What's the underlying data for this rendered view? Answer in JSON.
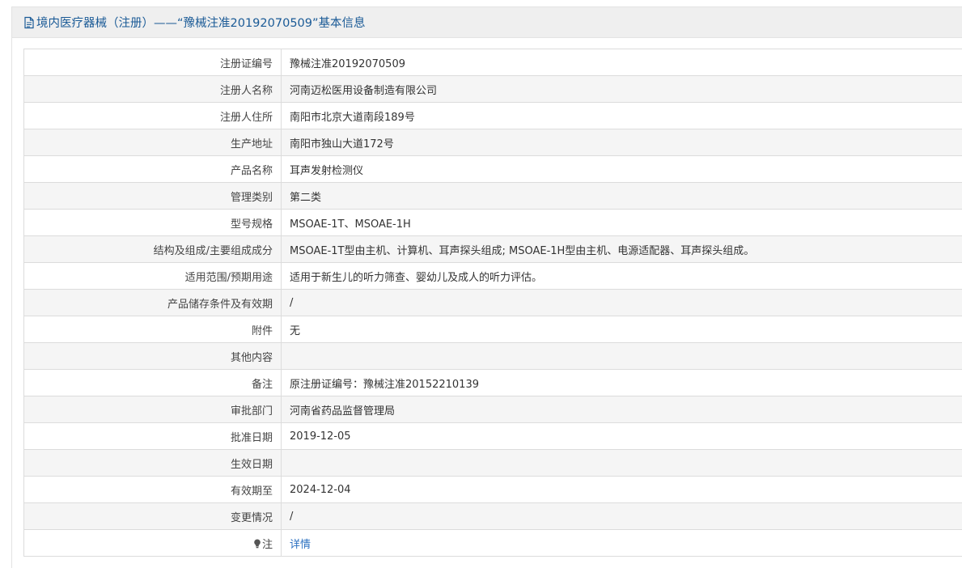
{
  "header": {
    "icon": "document-icon",
    "title": "境内医疗器械（注册）——“豫械注准20192070509”基本信息"
  },
  "rows": [
    {
      "label": "注册证编号",
      "value": "豫械注准20192070509"
    },
    {
      "label": "注册人名称",
      "value": "河南迈松医用设备制造有限公司"
    },
    {
      "label": "注册人住所",
      "value": "南阳市北京大道南段189号"
    },
    {
      "label": "生产地址",
      "value": "南阳市独山大道172号"
    },
    {
      "label": "产品名称",
      "value": "耳声发射检测仪"
    },
    {
      "label": "管理类别",
      "value": "第二类"
    },
    {
      "label": "型号规格",
      "value": "MSOAE-1T、MSOAE-1H"
    },
    {
      "label": "结构及组成/主要组成成分",
      "value": "MSOAE-1T型由主机、计算机、耳声探头组成; MSOAE-1H型由主机、电源适配器、耳声探头组成。"
    },
    {
      "label": "适用范围/预期用途",
      "value": "适用于新生儿的听力筛查、婴幼儿及成人的听力评估。"
    },
    {
      "label": "产品储存条件及有效期",
      "value": "/"
    },
    {
      "label": "附件",
      "value": "无"
    },
    {
      "label": "其他内容",
      "value": ""
    },
    {
      "label": "备注",
      "value": "原注册证编号：豫械注准20152210139"
    },
    {
      "label": "审批部门",
      "value": "河南省药品监督管理局"
    },
    {
      "label": "批准日期",
      "value": "2019-12-05"
    },
    {
      "label": "生效日期",
      "value": ""
    },
    {
      "label": "有效期至",
      "value": "2024-12-04"
    },
    {
      "label": "变更情况",
      "value": "/"
    }
  ],
  "note_row": {
    "icon": "lightbulb-icon",
    "label": "注",
    "link_text": "详情"
  },
  "colors": {
    "title": "#1a5a96",
    "link": "#2a6fc0",
    "header_bg": "#efefef",
    "row_alt_bg": "#f5f5f5",
    "border": "#dcdcdc"
  }
}
